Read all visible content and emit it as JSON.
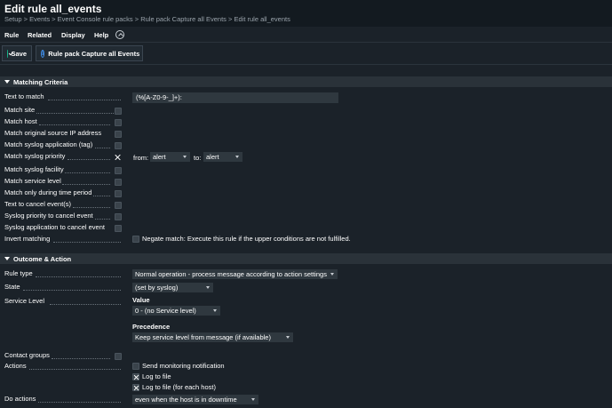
{
  "header": {
    "title": "Edit rule all_events",
    "breadcrumb": "Setup > Events > Event Console rule packs > Rule pack Capture all Events > Edit rule all_events"
  },
  "menu": {
    "items": [
      "Rule",
      "Related",
      "Display",
      "Help"
    ]
  },
  "toolbar": {
    "save_label": "Save",
    "rulepack_label": "Rule pack Capture all Events"
  },
  "matching": {
    "title": "Matching Criteria",
    "text_to_match_label": "Text to match",
    "text_to_match_value": "(%[A-Z0-9-_]+):",
    "rows": [
      "Match site",
      "Match host",
      "Match original source IP address",
      "Match syslog application (tag)",
      "Match syslog priority",
      "Match syslog facility",
      "Match service level",
      "Match only during time period",
      "Text to cancel event(s)",
      "Syslog priority to cancel event",
      "Syslog application to cancel event",
      "Invert matching"
    ],
    "priority_from_label": "from:",
    "priority_from_value": "alert",
    "priority_to_label": "to:",
    "priority_to_value": "alert",
    "negate_label": "Negate match: Execute this rule if the upper conditions are not fulfilled."
  },
  "outcome": {
    "title": "Outcome & Action",
    "rule_type_label": "Rule type",
    "rule_type_value": "Normal operation - process message according to action settings",
    "state_label": "State",
    "state_value": "(set by syslog)",
    "service_level_label": "Service Level",
    "value_label": "Value",
    "value_value": "0 - (no Service level)",
    "precedence_label": "Precedence",
    "precedence_value": "Keep service level from message (if available)",
    "contact_groups_label": "Contact groups",
    "actions_label": "Actions",
    "action_options": [
      "Send monitoring notification",
      "Log to file",
      "Log to file (for each host)"
    ],
    "do_actions_label": "Do actions",
    "do_actions_value": "even when the host is in downtime"
  },
  "colors": {
    "background": "#1b2229",
    "section_header": "#2a3239",
    "input": "#2f383f",
    "accent_green": "#16b68a"
  }
}
